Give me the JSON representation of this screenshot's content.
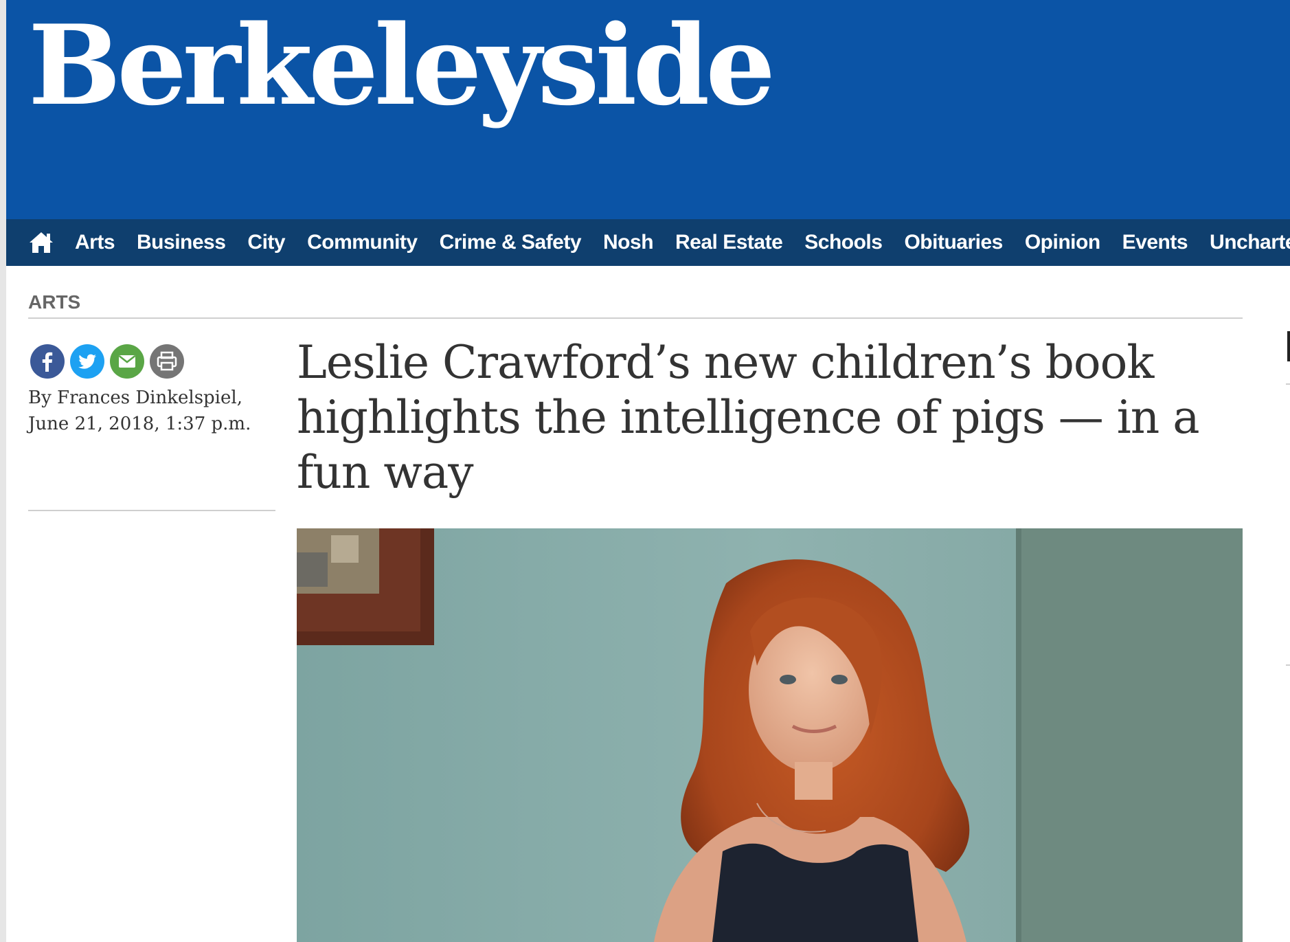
{
  "site": {
    "logo_text": "Berkeleyside",
    "brand_color": "#0b54a6",
    "nav_color": "#0f3f6e"
  },
  "nav": {
    "home_icon": "home-icon",
    "items": [
      {
        "label": "Arts"
      },
      {
        "label": "Business"
      },
      {
        "label": "City"
      },
      {
        "label": "Community"
      },
      {
        "label": "Crime & Safety"
      },
      {
        "label": "Nosh"
      },
      {
        "label": "Real Estate"
      },
      {
        "label": "Schools"
      },
      {
        "label": "Obituaries"
      },
      {
        "label": "Opinion"
      },
      {
        "label": "Events"
      },
      {
        "label": "Uncharted"
      }
    ]
  },
  "article": {
    "section": "ARTS",
    "byline": "By Frances Dinkelspiel,",
    "date": "June 21, 2018, 1:37 p.m.",
    "headline": "Leslie Crawford’s new children’s book highlights the intelligence of pigs — in a fun way",
    "share_icons": [
      "facebook-icon",
      "twitter-icon",
      "email-icon",
      "print-icon"
    ]
  }
}
